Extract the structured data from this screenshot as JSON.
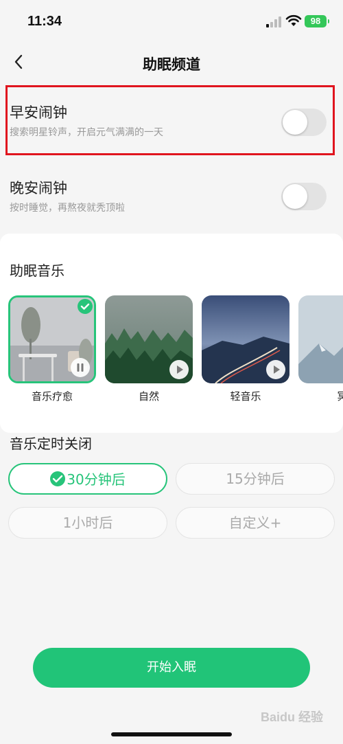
{
  "status_bar": {
    "time": "11:34",
    "battery": "98"
  },
  "nav": {
    "title": "助眠频道"
  },
  "alarms": [
    {
      "title": "早安闹钟",
      "subtitle": "搜索明星铃声，开启元气满满的一天",
      "enabled": false
    },
    {
      "title": "晚安闹钟",
      "subtitle": "按时睡觉，再熬夜就秃顶啦",
      "enabled": false
    }
  ],
  "music": {
    "title": "助眠音乐",
    "items": [
      {
        "label": "音乐疗愈",
        "selected": true,
        "state": "pause"
      },
      {
        "label": "自然",
        "selected": false,
        "state": "play"
      },
      {
        "label": "轻音乐",
        "selected": false,
        "state": "play"
      },
      {
        "label": "冥",
        "selected": false,
        "state": "play"
      }
    ]
  },
  "timer": {
    "title": "音乐定时关闭",
    "options": [
      {
        "label": "30分钟后",
        "active": true
      },
      {
        "label": "15分钟后",
        "active": false
      },
      {
        "label": "1小时后",
        "active": false
      },
      {
        "label": "自定义+",
        "active": false
      }
    ]
  },
  "start_button": "开始入眠",
  "watermark": "Baidu 经验",
  "colors": {
    "accent": "#21c478",
    "highlight": "#e0141e"
  }
}
